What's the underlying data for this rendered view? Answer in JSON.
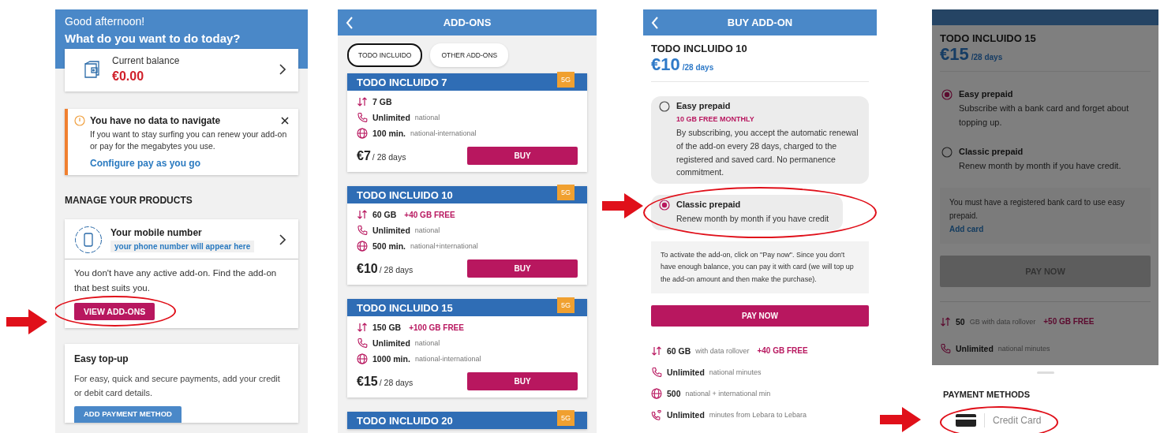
{
  "screens": [
    {
      "kind": "home",
      "greeting": "Good afternoon!",
      "question": "What do you want to do today?",
      "balance": {
        "label": "Current balance",
        "amount": "€0.00"
      },
      "alert": {
        "title": "You have no data to navigate",
        "text": "If you want to stay surfing you can renew your add-on or pay for the megabytes you use.",
        "link": "Configure pay as you go"
      },
      "section_title": "MANAGE YOUR PRODUCTS",
      "mobile": {
        "title": "Your mobile number",
        "subtitle": "your phone number will appear here"
      },
      "addon_message": "You don't have any active add-on. Find the add-on that best suits you.",
      "addon_button": "VIEW ADD-ONS",
      "topup": {
        "title": "Easy top-up",
        "text": "For easy, quick and secure payments, add your credit or debit card details.",
        "button": "ADD PAYMENT METHOD"
      }
    },
    {
      "kind": "addons",
      "title": "ADD-ONS",
      "tabs": [
        {
          "label": "TODO INCLUIDO",
          "selected": true
        },
        {
          "label": "OTHER ADD-ONS",
          "selected": false
        }
      ],
      "plans": [
        {
          "name": "TODO INCLUIDO 7",
          "badge": "5G",
          "features": [
            {
              "kind": "data",
              "value": "7 GB"
            },
            {
              "kind": "calls",
              "value": "Unlimited",
              "detail": "national"
            },
            {
              "kind": "international",
              "value": "100 min.",
              "detail": "national-international"
            }
          ],
          "price": "€7",
          "period": "/ 28 days",
          "button": "BUY"
        },
        {
          "name": "TODO INCLUIDO 10",
          "badge": "5G",
          "features": [
            {
              "kind": "data",
              "value": "60 GB",
              "extra": "+40 GB FREE"
            },
            {
              "kind": "calls",
              "value": "Unlimited",
              "detail": "national"
            },
            {
              "kind": "international",
              "value": "500 min.",
              "detail": "national+international"
            }
          ],
          "price": "€10",
          "period": "/ 28 days",
          "button": "BUY"
        },
        {
          "name": "TODO INCLUIDO 15",
          "badge": "5G",
          "features": [
            {
              "kind": "data",
              "value": "150 GB",
              "extra": "+100 GB FREE"
            },
            {
              "kind": "calls",
              "value": "Unlimited",
              "detail": "national"
            },
            {
              "kind": "international",
              "value": "1000 min.",
              "detail": "national-international"
            }
          ],
          "price": "€15",
          "period": "/ 28 days",
          "button": "BUY"
        },
        {
          "name": "TODO INCLUIDO 20",
          "badge": "5G"
        }
      ]
    },
    {
      "kind": "buy",
      "title": "BUY ADD-ON",
      "plan": "TODO INCLUIDO 10",
      "price": "€10",
      "period": "/28 days",
      "options": [
        {
          "label": "Easy prepaid",
          "highlight": "10 GB FREE MONTHLY",
          "text": "By subscribing, you accept the automatic renewal of the add-on every 28 days, charged to the registered and saved card. No permanence commitment.",
          "selected": false
        },
        {
          "label": "Classic prepaid",
          "text": "Renew month by month if you have credit",
          "selected": true
        }
      ],
      "notice": "To activate the add-on, click on \"Pay now\". Since you don't have enough balance, you can pay it with card (we will top up the add-on amount and then make the purchase).",
      "button": "PAY NOW",
      "button_disabled": false,
      "features": [
        {
          "kind": "data",
          "value": "60 GB",
          "detail": "with data rollover",
          "extra": "+40 GB FREE"
        },
        {
          "kind": "calls",
          "value": "Unlimited",
          "detail": "national minutes"
        },
        {
          "kind": "international",
          "value": "500",
          "detail": "national + international min"
        },
        {
          "kind": "lebara",
          "value": "Unlimited",
          "detail": "minutes from Lebara to Lebara"
        }
      ]
    },
    {
      "kind": "buy",
      "dimmed": true,
      "plan": "TODO INCLUIDO 15",
      "price": "€15",
      "period": "/28 days",
      "options": [
        {
          "label": "Easy prepaid",
          "text": "Subscribe with a bank card and forget about topping up.",
          "selected": true
        },
        {
          "label": "Classic prepaid",
          "text": "Renew month by month if you have credit.",
          "selected": false
        }
      ],
      "notice": "You must have a registered bank card to use easy prepaid.",
      "notice_link": "Add card",
      "button": "PAY NOW",
      "button_disabled": true,
      "features": [
        {
          "kind": "data",
          "value": "50",
          "detail": "GB with data rollover",
          "extra": "+50 GB FREE"
        },
        {
          "kind": "calls",
          "value": "Unlimited",
          "detail": "national minutes"
        }
      ],
      "sheet": {
        "title": "PAYMENT METHODS",
        "methods": [
          {
            "label": "Credit Card"
          }
        ]
      }
    }
  ]
}
